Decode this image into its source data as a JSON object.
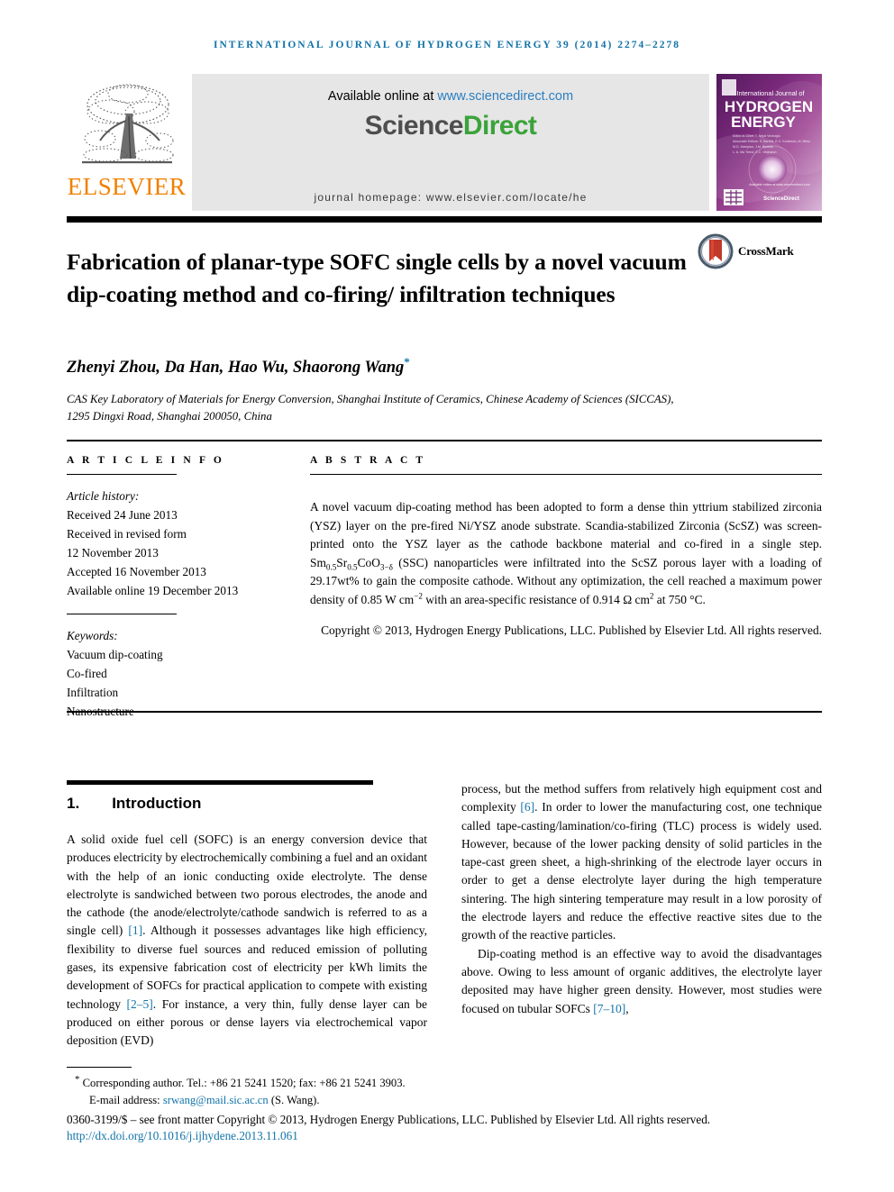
{
  "running_head": "INTERNATIONAL JOURNAL OF HYDROGEN ENERGY 39 (2014) 2274–2278",
  "masthead": {
    "publisher_name": "ELSEVIER",
    "publisher_logo_icon": "elsevier-tree-icon",
    "available_online_prefix": "Available online at ",
    "available_online_url": "www.sciencedirect.com",
    "sciencedirect_part1": "Science",
    "sciencedirect_part2": "Direct",
    "journal_homepage": "journal homepage: www.elsevier.com/locate/he",
    "cover": {
      "line1": "International Journal of",
      "line2": "HYDROGEN",
      "line3": "ENERGY",
      "editor_block": "Editor-in-Chief: T. Nejat Veziroğlu\nAssociate Editors: S. Bariş, E.C. Kardan, H.K. Abu Jalala, R.G. Peyerim, J.M. Bielicki, L. A. Ma, T. and E.C. Vedrazón",
      "footer_mark": "ScienceDirect"
    }
  },
  "article": {
    "title": "Fabrication of planar-type SOFC single cells by a novel vacuum dip-coating method and co-firing/ infiltration techniques",
    "crossmark_label": "CrossMark",
    "crossmark_icon": "crossmark-icon",
    "authors": "Zhenyi Zhou, Da Han, Hao Wu, Shaorong Wang",
    "corresponding_marker": "*",
    "affiliation": "CAS Key Laboratory of Materials for Energy Conversion, Shanghai Institute of Ceramics, Chinese Academy of Sciences (SICCAS), 1295 Dingxi Road, Shanghai 200050, China"
  },
  "article_info": {
    "heading": "A R T I C L E   I N F O",
    "history_label": "Article history:",
    "history": [
      "Received 24 June 2013",
      "Received in revised form",
      "12 November 2013",
      "Accepted 16 November 2013",
      "Available online 19 December 2013"
    ],
    "keywords_label": "Keywords:",
    "keywords": [
      "Vacuum dip-coating",
      "Co-fired",
      "Infiltration",
      "Nanostructure"
    ]
  },
  "abstract": {
    "heading": "A B S T R A C T",
    "copyright": "Copyright © 2013, Hydrogen Energy Publications, LLC. Published by Elsevier Ltd. All rights reserved."
  },
  "introduction": {
    "number": "1.",
    "heading": "Introduction"
  },
  "footer": {
    "corresponding_line": "Corresponding author. Tel.: +86 21 5241 1520; fax: +86 21 5241 3903.",
    "corresponding_label": "Corresponding author",
    "email_label": "E-mail address: ",
    "email": "srwang@mail.sic.ac.cn",
    "email_suffix": " (S. Wang).",
    "issn_line": "0360-3199/$ – see front matter Copyright © 2013, Hydrogen Energy Publications, LLC. Published by Elsevier Ltd. All rights reserved.",
    "doi": "http://dx.doi.org/10.1016/j.ijhydene.2013.11.061"
  },
  "colors": {
    "link_blue": "#1273a8",
    "elsevier_orange": "#f08000",
    "sciencedirect_green": "#3aa33a",
    "masthead_grey": "#e6e6e6"
  }
}
